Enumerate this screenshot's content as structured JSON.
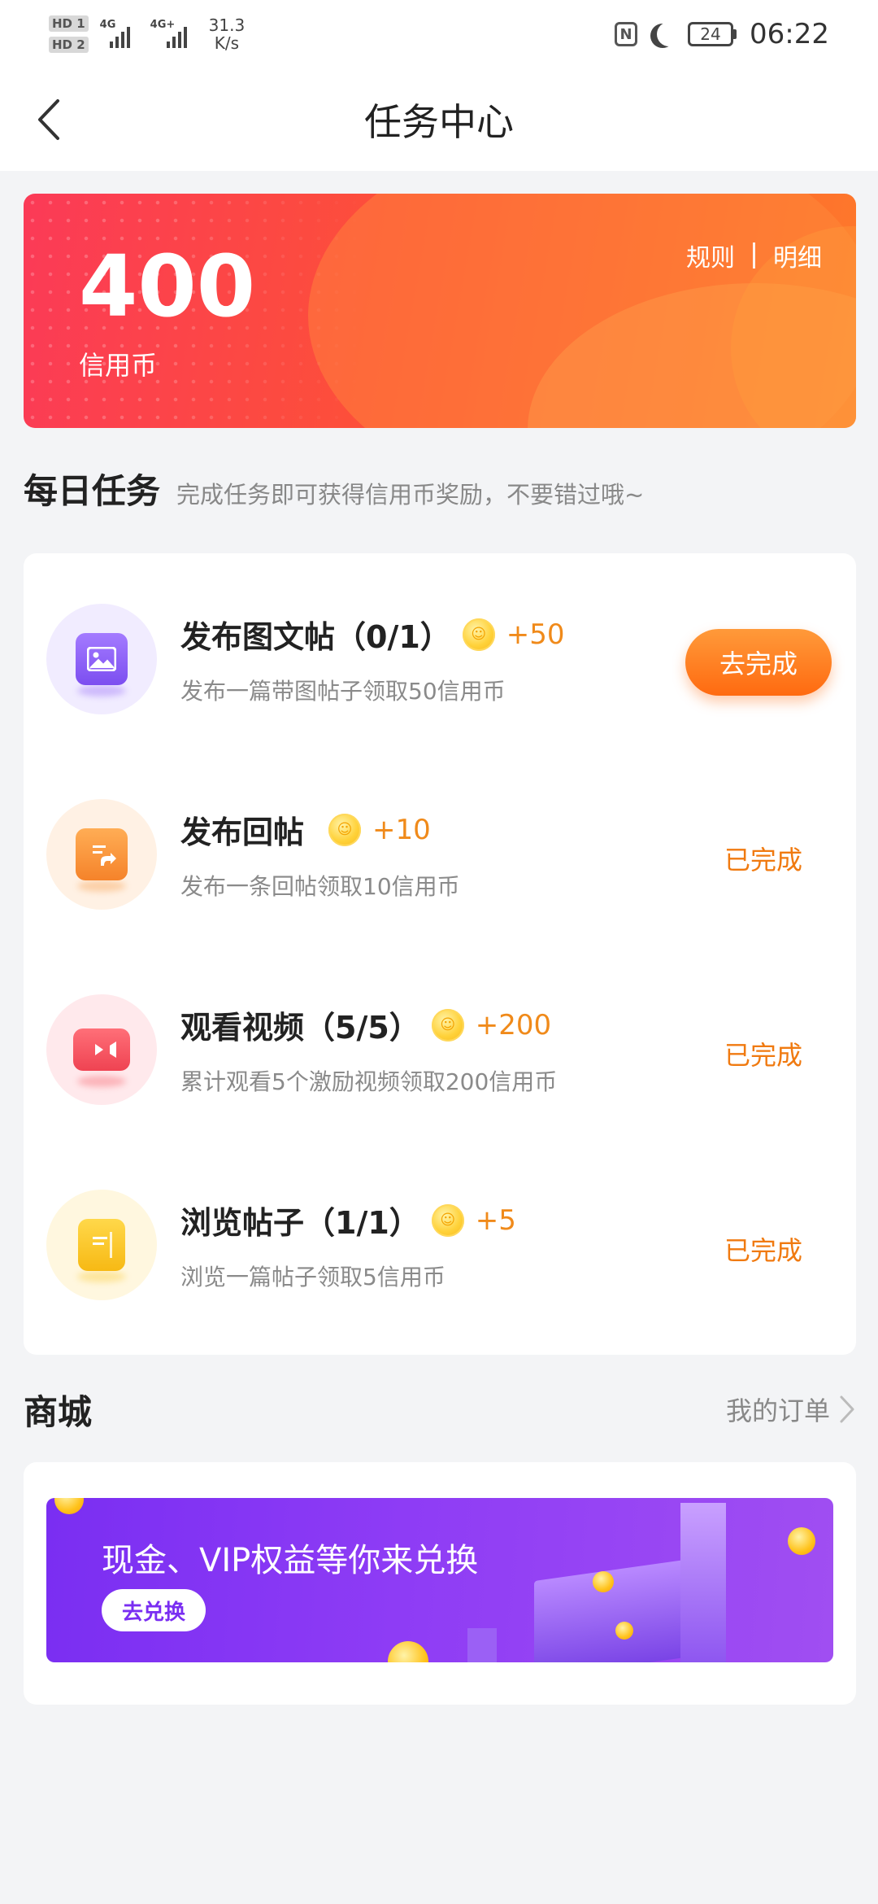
{
  "status_bar": {
    "hd1": "HD 1",
    "hd2": "HD 2",
    "net1": "4G",
    "net2": "4G+",
    "speed_value": "31.3",
    "speed_unit": "K/s",
    "nfc": "N",
    "battery": "24",
    "time": "06:22"
  },
  "header": {
    "title": "任务中心"
  },
  "banner": {
    "credit_value": "400",
    "credit_label": "信用币",
    "rules_link": "规则",
    "details_link": "明细"
  },
  "daily": {
    "title": "每日任务",
    "subtitle": "完成任务即可获得信用币奖励，不要错过哦~",
    "tasks": [
      {
        "name": "发布图文帖（0/1）",
        "reward": "+50",
        "desc": "发布一篇带图帖子领取50信用币",
        "action": "去完成",
        "icon": "image-icon",
        "icon_color": "#8b5cf6",
        "icon_bg": "#f1ecff"
      },
      {
        "name": "发布回帖",
        "reward": "+10",
        "desc": "发布一条回帖领取10信用币",
        "action": "已完成",
        "icon": "reply-post-icon",
        "icon_color": "#f59236",
        "icon_bg": "#fff1e4"
      },
      {
        "name": "观看视频（5/5）",
        "reward": "+200",
        "desc": "累计观看5个激励视频领取200信用币",
        "action": "已完成",
        "icon": "video-icon",
        "icon_color": "#f5515c",
        "icon_bg": "#ffe9ec"
      },
      {
        "name": "浏览帖子（1/1）",
        "reward": "+5",
        "desc": "浏览一篇帖子领取5信用币",
        "action": "已完成",
        "icon": "browse-post-icon",
        "icon_color": "#f9c41f",
        "icon_bg": "#fff7df"
      }
    ]
  },
  "mall": {
    "title": "商城",
    "orders_link": "我的订单",
    "banner_text": "现金、VIP权益等你来兑换",
    "banner_button": "去兑换"
  },
  "colors": {
    "accent_orange": "#ff6a10",
    "done_text": "#f07a10",
    "banner_red": "#fb3a57",
    "mall_purple": "#7a2ef2"
  }
}
